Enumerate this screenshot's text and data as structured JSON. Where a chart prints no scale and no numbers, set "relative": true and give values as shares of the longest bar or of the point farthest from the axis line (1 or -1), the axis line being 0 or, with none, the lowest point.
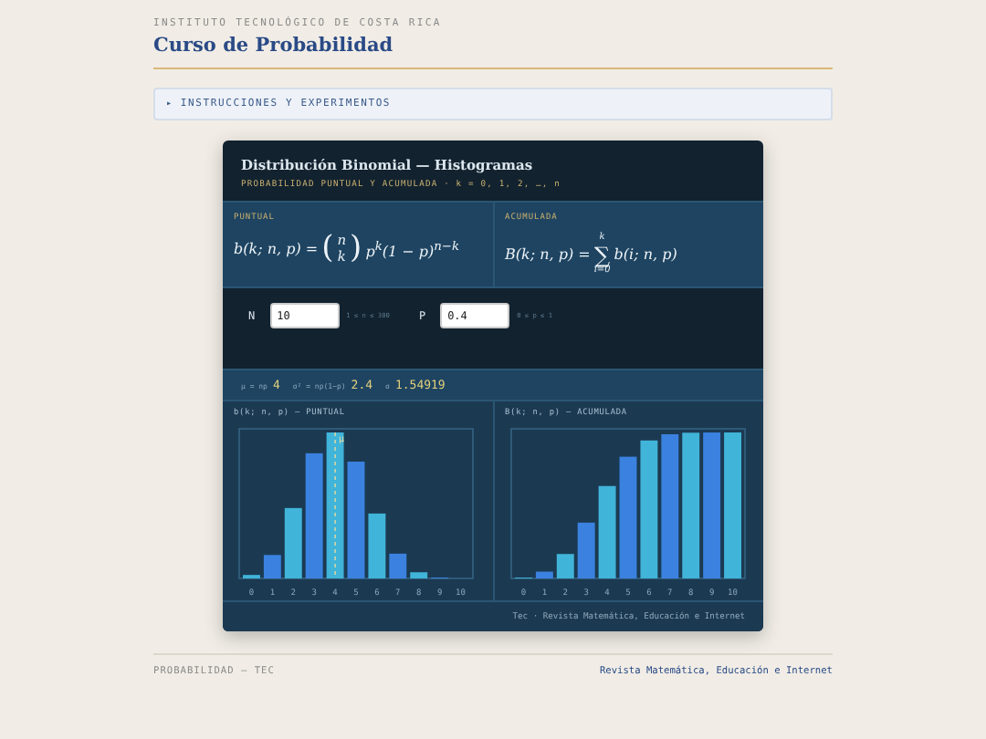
{
  "header": {
    "institution": "INSTITUTO TECNOLÓGICO DE COSTA RICA",
    "title": "Curso de Probabilidad"
  },
  "disclosure": {
    "marker": "▸",
    "label": "INSTRUCCIONES Y EXPERIMENTOS",
    "expanded": false
  },
  "card": {
    "title": "Distribución Binomial — Histogramas",
    "subtitle": "PROBABILIDAD PUNTUAL Y ACUMULADA · k = 0, 1, 2, …, n",
    "formulas": [
      {
        "label": "PUNTUAL",
        "kind": "binomial",
        "lhs": "b(k; n, p) =",
        "open": "(",
        "top": "n",
        "bottom": "k",
        "close": ")",
        "rhs": "p$^{k}$(1 − p)$^{n−k}$"
      },
      {
        "label": "ACUMULADA",
        "kind": "sum",
        "lhs": "B(k; n, p) =",
        "sigma": "∑",
        "top": "k",
        "bottom": "i=0",
        "rhs": "b(i; n, p)"
      }
    ],
    "inputs": [
      {
        "label": "N",
        "value": "10",
        "hint": "1 ≤ n ≤ 300"
      },
      {
        "label": "P",
        "value": "0.4",
        "hint": "0 ≤ p ≤ 1"
      }
    ],
    "stats": [
      {
        "label": "μ = np",
        "value": "4"
      },
      {
        "label": "σ² = np(1−p)",
        "value": "2.4"
      },
      {
        "label": "σ",
        "value": "1.54919"
      }
    ],
    "charts": [
      {
        "title": "b(k; n, p) — PUNTUAL",
        "chart_data": {
          "type": "bar",
          "relative": true,
          "categories": [
            "0",
            "1",
            "2",
            "3",
            "4",
            "5",
            "6",
            "7",
            "8",
            "9",
            "10"
          ],
          "ref_lines": [
            {
              "axis": "x",
              "value": "4",
              "label": "μ"
            }
          ],
          "values": [
            0.0239,
            0.1607,
            0.4821,
            0.8573,
            1,
            0.8002,
            0.4446,
            0.1695,
            0.0423,
            0.0064,
            null
          ]
        }
      },
      {
        "title": "B(k; n, p) — ACUMULADA",
        "chart_data": {
          "type": "bar",
          "relative": true,
          "categories": [
            "0",
            "1",
            "2",
            "3",
            "4",
            "5",
            "6",
            "7",
            "8",
            "9",
            "10"
          ],
          "values": [
            0.006,
            0.0464,
            0.1673,
            0.3823,
            0.6331,
            0.8338,
            0.9452,
            0.9877,
            0.9983,
            0.9999,
            1.0
          ]
        }
      }
    ],
    "credit": "Tec · Revista Matemática, Educación e Internet"
  },
  "footer": {
    "left": "PROBABILIDAD — TEC",
    "right": "Revista Matemática, Educación e Internet"
  }
}
